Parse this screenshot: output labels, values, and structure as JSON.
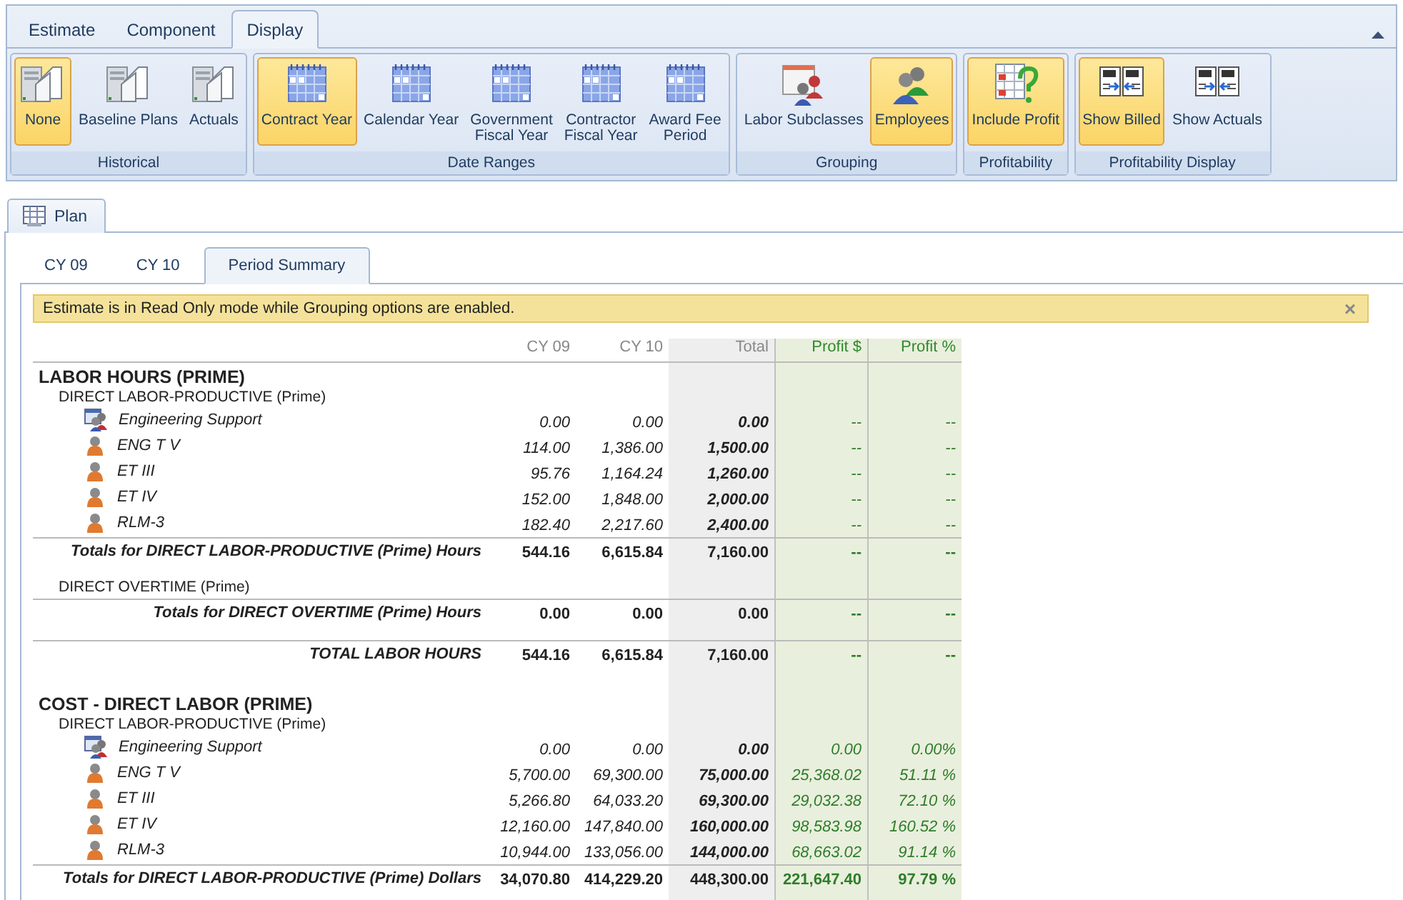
{
  "ribbon": {
    "tabs": [
      {
        "label": "Estimate",
        "selected": false
      },
      {
        "label": "Component",
        "selected": false
      },
      {
        "label": "Display",
        "selected": true
      }
    ],
    "groups": [
      {
        "label": "Historical",
        "buttons": [
          {
            "label": "None",
            "kind": "docs",
            "selected": true
          },
          {
            "label": "Baseline Plans",
            "kind": "docs",
            "selected": false
          },
          {
            "label": "Actuals",
            "kind": "docs",
            "selected": false
          }
        ]
      },
      {
        "label": "Date Ranges",
        "buttons": [
          {
            "label": "Contract Year",
            "kind": "calendar",
            "selected": true
          },
          {
            "label": "Calendar Year",
            "kind": "calendar",
            "selected": false
          },
          {
            "label": "Government\nFiscal Year",
            "kind": "calendar",
            "selected": false
          },
          {
            "label": "Contractor\nFiscal Year",
            "kind": "calendar",
            "selected": false
          },
          {
            "label": "Award Fee\nPeriod",
            "kind": "calendar",
            "selected": false
          }
        ]
      },
      {
        "label": "Grouping",
        "buttons": [
          {
            "label": "Labor Subclasses",
            "kind": "calpeople",
            "selected": false
          },
          {
            "label": "Employees",
            "kind": "people",
            "selected": true
          }
        ]
      },
      {
        "label": "Profitability",
        "buttons": [
          {
            "label": "Include Profit",
            "kind": "profit",
            "selected": true
          }
        ]
      },
      {
        "label": "Profitability Display",
        "buttons": [
          {
            "label": "Show Billed",
            "kind": "numbers",
            "selected": true
          },
          {
            "label": "Show Actuals",
            "kind": "numbers",
            "selected": false
          }
        ]
      }
    ]
  },
  "doc_tabs": [
    {
      "label": "Plan",
      "selected": true
    }
  ],
  "period_tabs": [
    {
      "label": "CY 09",
      "selected": false
    },
    {
      "label": "CY 10",
      "selected": false
    },
    {
      "label": "Period Summary",
      "selected": true
    }
  ],
  "banner": {
    "text": "Estimate is in Read Only mode while Grouping options are enabled.",
    "close": "×"
  },
  "table": {
    "columns": [
      "CY 09",
      "CY 10",
      "Total",
      "Profit $",
      "Profit %"
    ],
    "rows": [
      {
        "kind": "section",
        "label": "LABOR HOURS (PRIME)"
      },
      {
        "kind": "group",
        "label": "DIRECT LABOR-PRODUCTIVE (Prime)"
      },
      {
        "kind": "team",
        "label": "Engineering Support",
        "values": [
          "0.00",
          "0.00",
          "0.00",
          "--",
          "--"
        ]
      },
      {
        "kind": "person",
        "label": "ENG T V",
        "values": [
          "114.00",
          "1,386.00",
          "1,500.00",
          "--",
          "--"
        ]
      },
      {
        "kind": "person",
        "label": "ET III",
        "values": [
          "95.76",
          "1,164.24",
          "1,260.00",
          "--",
          "--"
        ]
      },
      {
        "kind": "person",
        "label": "ET IV",
        "values": [
          "152.00",
          "1,848.00",
          "2,000.00",
          "--",
          "--"
        ]
      },
      {
        "kind": "person",
        "label": "RLM-3",
        "values": [
          "182.40",
          "2,217.60",
          "2,400.00",
          "--",
          "--"
        ]
      },
      {
        "kind": "total",
        "label": "Totals for DIRECT LABOR-PRODUCTIVE (Prime) Hours",
        "values": [
          "544.16",
          "6,615.84",
          "7,160.00",
          "--",
          "--"
        ]
      },
      {
        "kind": "group",
        "label": "DIRECT OVERTIME (Prime)"
      },
      {
        "kind": "total",
        "label": "Totals for DIRECT OVERTIME (Prime) Hours",
        "values": [
          "0.00",
          "0.00",
          "0.00",
          "--",
          "--"
        ]
      },
      {
        "kind": "grand",
        "label": "TOTAL LABOR HOURS",
        "values": [
          "544.16",
          "6,615.84",
          "7,160.00",
          "--",
          "--"
        ]
      },
      {
        "kind": "section",
        "label": "COST - DIRECT LABOR (PRIME)"
      },
      {
        "kind": "group",
        "label": "DIRECT LABOR-PRODUCTIVE (Prime)"
      },
      {
        "kind": "team",
        "label": "Engineering Support",
        "values": [
          "0.00",
          "0.00",
          "0.00",
          "0.00",
          "0.00%"
        ]
      },
      {
        "kind": "person",
        "label": "ENG T V",
        "values": [
          "5,700.00",
          "69,300.00",
          "75,000.00",
          "25,368.02",
          "51.11 %"
        ]
      },
      {
        "kind": "person",
        "label": "ET III",
        "values": [
          "5,266.80",
          "64,033.20",
          "69,300.00",
          "29,032.38",
          "72.10 %"
        ]
      },
      {
        "kind": "person",
        "label": "ET IV",
        "values": [
          "12,160.00",
          "147,840.00",
          "160,000.00",
          "98,583.98",
          "160.52 %"
        ]
      },
      {
        "kind": "person",
        "label": "RLM-3",
        "values": [
          "10,944.00",
          "133,056.00",
          "144,000.00",
          "68,663.02",
          "91.14 %"
        ]
      },
      {
        "kind": "total",
        "label": "Totals for DIRECT LABOR-PRODUCTIVE (Prime) Dollars",
        "values": [
          "34,070.80",
          "414,229.20",
          "448,300.00",
          "221,647.40",
          "97.79 %"
        ]
      }
    ]
  }
}
